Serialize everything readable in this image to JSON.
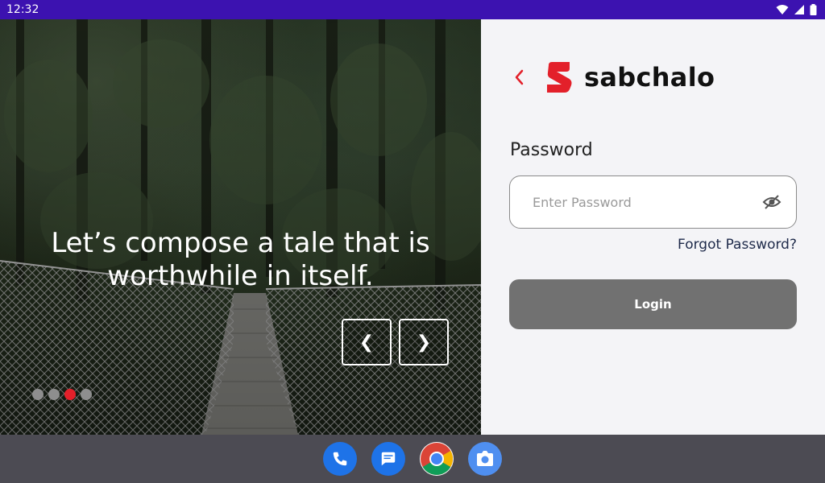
{
  "status_bar": {
    "time": "12:32"
  },
  "hero": {
    "line1": "Let’s compose a tale that is",
    "line2": "worthwhile in itself.",
    "prev_label": "❮",
    "next_label": "❯",
    "carousel": {
      "total": 4,
      "active_index": 2
    }
  },
  "login": {
    "brand_name": "sabchalo",
    "password_label": "Password",
    "password_placeholder": "Enter Password",
    "password_value": "",
    "forgot_label": "Forgot Password?",
    "login_label": "Login"
  },
  "dock": {
    "apps": [
      {
        "name": "phone-icon"
      },
      {
        "name": "messages-icon"
      },
      {
        "name": "chrome-icon"
      },
      {
        "name": "camera-icon"
      }
    ]
  },
  "colors": {
    "status_bar": "#3c12b0",
    "brand_red": "#e3202a",
    "login_button": "#717171",
    "panel_bg": "#f4f4f7",
    "dock_bg": "#4c4b53"
  }
}
